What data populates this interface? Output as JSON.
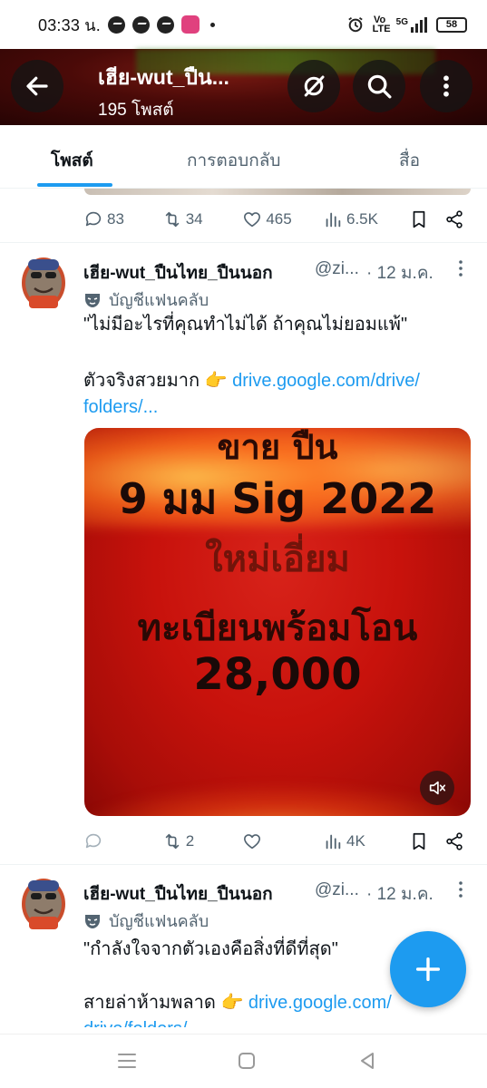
{
  "status_bar": {
    "time": "03:33 น.",
    "volte_label": "Vo LTE",
    "network_label": "5G",
    "battery": "58"
  },
  "header": {
    "title": "เฮีย-wut_ปืน...",
    "post_count": "195 โพสต์"
  },
  "tabs": [
    {
      "label": "โพสต์",
      "active": true
    },
    {
      "label": "การตอบกลับ",
      "active": false
    },
    {
      "label": "สื่อ",
      "active": false
    }
  ],
  "prev_tweet": {
    "replies": "83",
    "retweets": "34",
    "likes": "465",
    "views": "6.5K"
  },
  "tweets": [
    {
      "name": "เฮีย-wut_ปืนไทย_ปืนนอก",
      "handle": "@zi...",
      "date": "· 12 ม.ค.",
      "fan_label": "บัญชีแฟนคลับ",
      "text_line1": "\"ไม่มีอะไรที่คุณทำไม่ได้ ถ้าคุณไม่ยอมแพ้\"",
      "text_line2": "ตัวจริงสวยมาก 👉 ",
      "link_part1": "drive.google.com/drive/",
      "link_part2": "folders/...",
      "media": {
        "line_top": "ขาย ปืน",
        "line1": "9 มม Sig 2022",
        "line2": "ใหม่เอี่ยม",
        "line3": "ทะเบียนพร้อมโอน",
        "line4": "28,000"
      },
      "replies": "",
      "retweets": "2",
      "likes": "",
      "views": "4K"
    },
    {
      "name": "เฮีย-wut_ปืนไทย_ปืนนอก",
      "handle": "@zi...",
      "date": "· 12 ม.ค.",
      "fan_label": "บัญชีแฟนคลับ",
      "text_line1": "\"กำลังใจจากตัวเองคือสิ่งที่ดีที่สุด\"",
      "text_line2": "สายล่าห้ามพลาด 👉 ",
      "link_part1": "drive.google.com/",
      "link_part2": "drive/folders/..."
    }
  ],
  "colors": {
    "accent": "#1d9bf0",
    "text": "#0f1419",
    "muted": "#536471"
  }
}
